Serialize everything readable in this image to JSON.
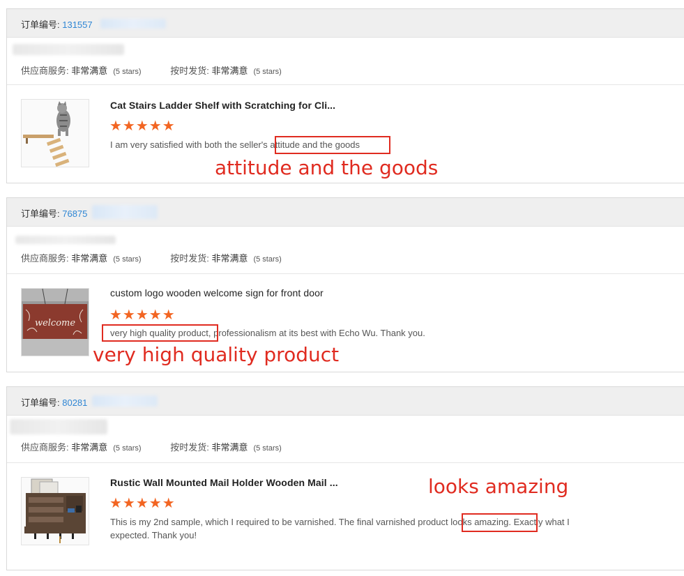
{
  "orders": [
    {
      "order_label": "订单编号: ",
      "order_number": "131557",
      "supplier_service_label": "供应商服务: ",
      "supplier_service_value": "非常满意",
      "supplier_service_stars": "(5 stars)",
      "shipping_label": "按时发货: ",
      "shipping_value": "非常满意",
      "shipping_stars": "(5 stars)",
      "product_title": "Cat Stairs Ladder Shelf with Scratching for Cli...",
      "rating": "★★★★★",
      "review_before": "I am very satisfied with both the seller's ",
      "review_highlight": "attitude and the goods",
      "review_after": "",
      "annotation": "attitude and the goods",
      "thumbnail_icon": "cat-shelf-image"
    },
    {
      "order_label": "订单编号: ",
      "order_number": "76875",
      "supplier_service_label": "供应商服务: ",
      "supplier_service_value": "非常满意",
      "supplier_service_stars": "(5 stars)",
      "shipping_label": "按时发货: ",
      "shipping_value": "非常满意",
      "shipping_stars": "(5 stars)",
      "product_title": "custom logo wooden welcome sign for front door",
      "rating": "★★★★★",
      "review_before": "",
      "review_highlight": "very high quality product",
      "review_after": ", professionalism at its best with Echo Wu. Thank you.",
      "annotation": "very high quality product",
      "thumbnail_icon": "welcome-sign-image",
      "thumbnail_text": "welcome"
    },
    {
      "order_label": "订单编号: ",
      "order_number": "80281",
      "supplier_service_label": "供应商服务: ",
      "supplier_service_value": "非常满意",
      "supplier_service_stars": "(5 stars)",
      "shipping_label": "按时发货: ",
      "shipping_value": "非常满意",
      "shipping_stars": "(5 stars)",
      "product_title": "Rustic Wall Mounted Mail Holder Wooden Mail ...",
      "rating": "★★★★★",
      "review_before": "This is my 2nd sample, which I required to be varnished. The final varnished product ",
      "review_highlight": "looks amazing",
      "review_after": ". Exactly what I expected. Thank you!",
      "annotation": "looks amazing",
      "thumbnail_icon": "mail-holder-image"
    }
  ],
  "colors": {
    "star": "#f26522",
    "annotation": "#e02b20",
    "order_number": "#2f86d4",
    "header_bg": "#efefef"
  }
}
